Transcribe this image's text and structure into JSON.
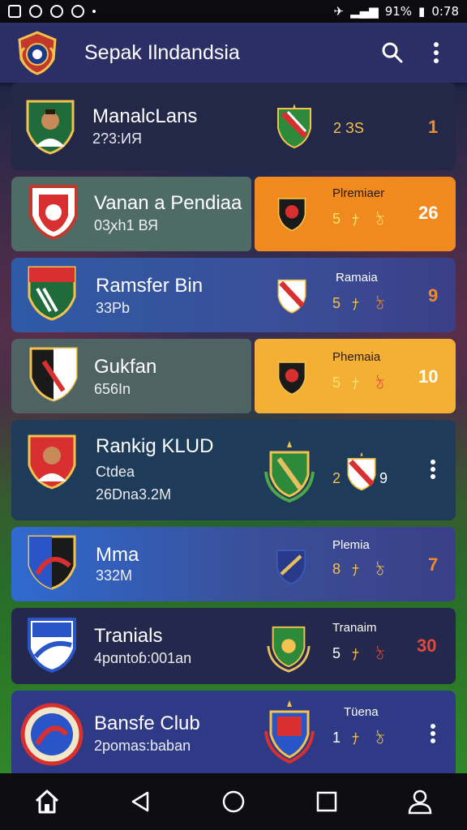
{
  "status": {
    "battery": "91%",
    "time": "0:78"
  },
  "app": {
    "title": "Sepak Ilndandsia"
  },
  "rows": [
    {
      "name": "ManalcLans",
      "sub": "2?3:ИЯ",
      "num": "2 ЗЅ",
      "score": "1"
    },
    {
      "name": "Vanan a Pendiaa",
      "sub": "03ꭗh1 ВЯ",
      "label": "Рlremiaer",
      "num": "5",
      "score": "26"
    },
    {
      "name": "Ramsfer Bin",
      "sub": "33Pb",
      "label": "Ramaia",
      "num": "5",
      "score": "9"
    },
    {
      "name": "Gukfan",
      "sub": "656In",
      "label": "Phemaia",
      "num": "5",
      "score": "10"
    },
    {
      "name": "Rankig KLUD",
      "sub": "Ctdea",
      "sub2": "26Dna3.2M",
      "num": "2",
      "num2": "9"
    },
    {
      "name": "Mma",
      "sub": "332M",
      "label": "Plemia",
      "num": "8",
      "score": "7"
    },
    {
      "name": "Tranials",
      "sub": "4pɑntoɓ:001an",
      "label": "Tranaim",
      "num": "5",
      "score": "30"
    },
    {
      "name": "Bansfe Club",
      "sub": "2pomas:baban",
      "label": "Tüena",
      "num": "1"
    }
  ],
  "colors": {
    "appbar": "#2b2f66",
    "orange": "#f08a1e",
    "gold": "#f3b035",
    "score_orange": "#f08a2a",
    "score_red": "#e04a3a"
  }
}
